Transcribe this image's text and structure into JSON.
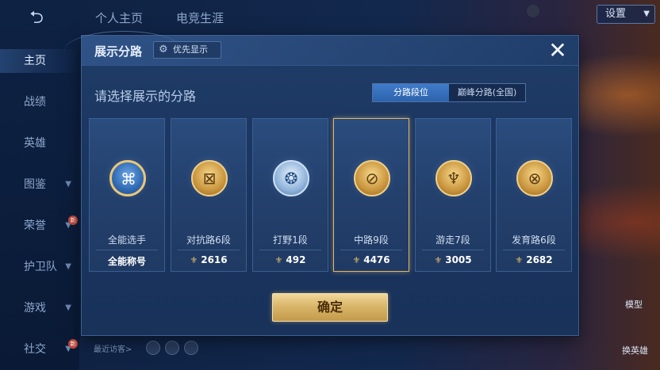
{
  "nav": {
    "items": [
      {
        "label": "主页",
        "active": true,
        "chevron": false,
        "badge": ""
      },
      {
        "label": "战绩",
        "active": false,
        "chevron": false,
        "badge": ""
      },
      {
        "label": "英雄",
        "active": false,
        "chevron": false,
        "badge": ""
      },
      {
        "label": "图鉴",
        "active": false,
        "chevron": true,
        "badge": ""
      },
      {
        "label": "荣誉",
        "active": false,
        "chevron": true,
        "badge": "新"
      },
      {
        "label": "护卫队",
        "active": false,
        "chevron": true,
        "badge": ""
      },
      {
        "label": "游戏",
        "active": false,
        "chevron": true,
        "badge": ""
      },
      {
        "label": "社交",
        "active": false,
        "chevron": true,
        "badge": "新"
      }
    ]
  },
  "top_tabs": [
    "个人主页",
    "电竞生涯"
  ],
  "settings_label": "设置",
  "recent_visitors_label": "最近访客>",
  "right_labels": {
    "model": "模型",
    "swap_hero": "换英雄"
  },
  "dialog": {
    "title": "展示分路",
    "priority_label": "优先显示",
    "close_glyph": "✕",
    "subtitle": "请选择展示的分路",
    "segments": [
      {
        "label": "分路段位",
        "active": true
      },
      {
        "label": "巅峰分路(全国)",
        "active": false
      }
    ],
    "cards": [
      {
        "name": "全能选手",
        "score": "全能称号",
        "show_cup": false,
        "selected": false,
        "badge_style": "blue",
        "icon": "all-round-icon",
        "glyph": "⌘"
      },
      {
        "name": "对抗路6段",
        "score": "2616",
        "show_cup": true,
        "selected": false,
        "badge_style": "gold",
        "icon": "clash-lane-icon",
        "glyph": "⊠"
      },
      {
        "name": "打野1段",
        "score": "492",
        "show_cup": true,
        "selected": false,
        "badge_style": "silver",
        "icon": "jungle-icon",
        "glyph": "❂"
      },
      {
        "name": "中路9段",
        "score": "4476",
        "show_cup": true,
        "selected": true,
        "badge_style": "gold",
        "icon": "mid-lane-icon",
        "glyph": "⊘"
      },
      {
        "name": "游走7段",
        "score": "3005",
        "show_cup": true,
        "selected": false,
        "badge_style": "gold",
        "icon": "roam-icon",
        "glyph": "♆"
      },
      {
        "name": "发育路6段",
        "score": "2682",
        "show_cup": true,
        "selected": false,
        "badge_style": "gold",
        "icon": "farm-lane-icon",
        "glyph": "⊗"
      }
    ],
    "confirm_label": "确定"
  },
  "colors": {
    "accent_gold": "#e2b66a",
    "segment_active": "#3f7cc9",
    "dialog_bg": "#1b3660"
  }
}
